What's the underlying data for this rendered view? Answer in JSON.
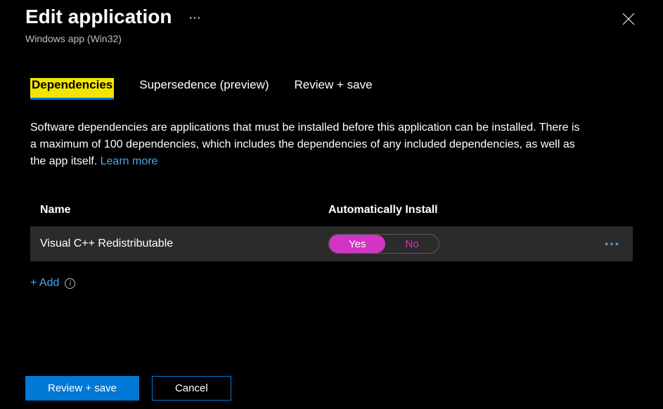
{
  "header": {
    "title": "Edit application",
    "subtitle": "Windows app (Win32)"
  },
  "tabs": {
    "dependencies": "Dependencies",
    "supersedence": "Supersedence (preview)",
    "review_save": "Review + save"
  },
  "description": {
    "text": "Software dependencies are applications that must be installed before this application can be installed. There is a maximum of 100 dependencies, which includes the dependencies of any included dependencies, as well as the app itself. ",
    "learn_more": "Learn more"
  },
  "table": {
    "headers": {
      "name": "Name",
      "auto_install": "Automatically Install"
    },
    "rows": [
      {
        "name": "Visual C++ Redistributable",
        "auto_install": "Yes"
      }
    ],
    "toggle": {
      "yes": "Yes",
      "no": "No"
    }
  },
  "add_link": "+ Add",
  "footer": {
    "review_save": "Review + save",
    "cancel": "Cancel"
  }
}
